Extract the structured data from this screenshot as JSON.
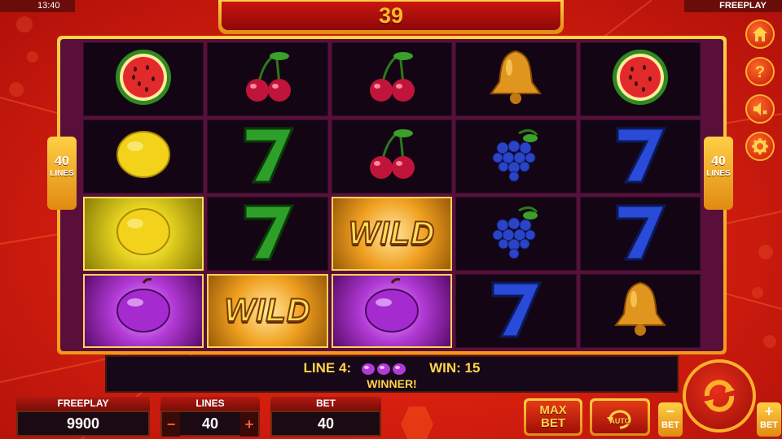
{
  "status": {
    "time": "13:40",
    "mode": "FREEPLAY"
  },
  "counter": "39",
  "lines_left": {
    "count": "40",
    "label": "LINES"
  },
  "lines_right": {
    "count": "40",
    "label": "LINES"
  },
  "reels": [
    [
      "watermelon",
      "cherries",
      "cherries",
      "bell",
      "watermelon"
    ],
    [
      "lemon",
      "seven-green",
      "cherries",
      "grapes",
      "seven-blue"
    ],
    [
      "lemon",
      "seven-green",
      "wild",
      "grapes",
      "seven-blue"
    ],
    [
      "plum",
      "wild",
      "plum",
      "seven-blue",
      "bell"
    ]
  ],
  "wild_label": "WILD",
  "win_message": {
    "line": "LINE 4:",
    "win": "WIN: 15",
    "winner": "WINNER!"
  },
  "side_menu": [
    "home-icon",
    "help-icon",
    "sound-off-icon",
    "settings-icon"
  ],
  "bottom": {
    "freeplay": {
      "label": "FREEPLAY",
      "value": "9900"
    },
    "lines": {
      "label": "LINES",
      "value": "40",
      "minus": "−",
      "plus": "+"
    },
    "bet": {
      "label": "BET",
      "value": "40"
    },
    "max_bet": {
      "line1": "MAX",
      "line2": "BET"
    },
    "auto": "AUTO",
    "bet_minus": {
      "symbol": "−",
      "label": "BET"
    },
    "bet_plus": {
      "symbol": "+",
      "label": "BET"
    }
  },
  "colors": {
    "background": "#d8200f",
    "gold": "#ffcf45",
    "reel_bg": "#140514",
    "text_gold": "#ffd44a"
  }
}
